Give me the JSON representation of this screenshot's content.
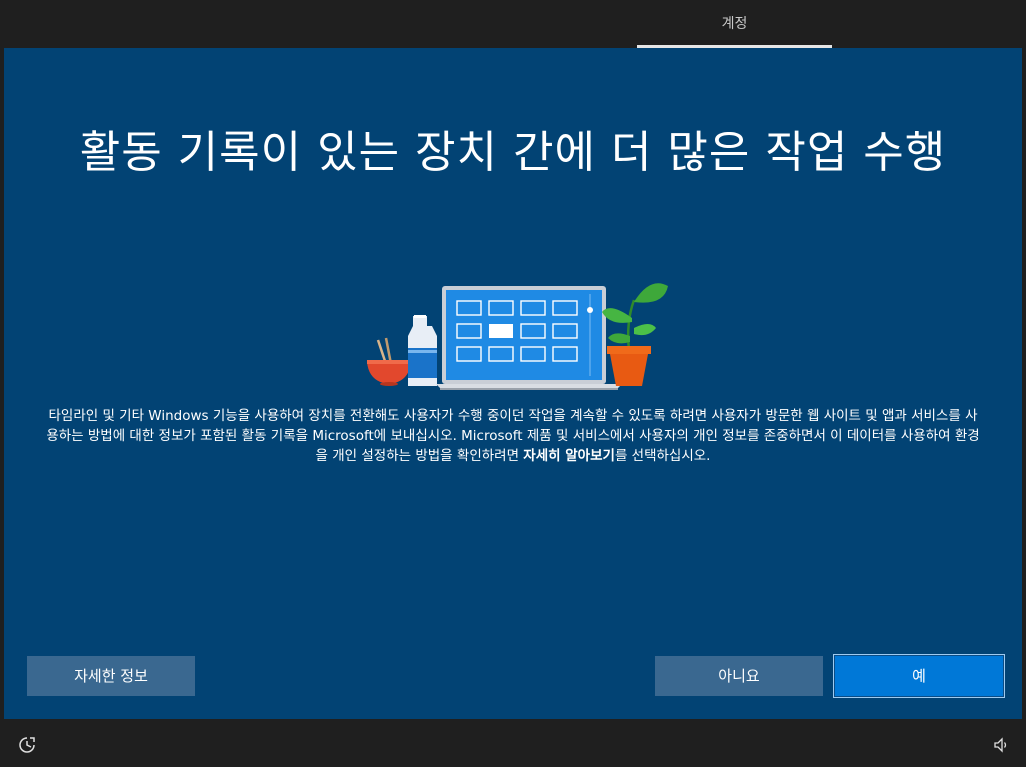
{
  "header": {
    "tab_label": "계정"
  },
  "main": {
    "title": "활동 기록이 있는 장치 간에 더 많은 작업 수행",
    "description_parts": {
      "before_link": "타임라인 및 기타 Windows 기능을 사용하여 장치를 전환해도 사용자가 수행 중이던 작업을 계속할 수 있도록 하려면 사용자가 방문한 웹 사이트 및 앱과 서비스를 사용하는 방법에 대한 정보가 포함된 활동 기록을 Microsoft에 보내십시오. Microsoft 제품 및 서비스에서 사용자의 개인 정보를 존중하면서 이 데이터를 사용하여 환경을 개인 설정하는 방법을 확인하려면 ",
      "link": "자세히 알아보기",
      "after_link": "를 선택하십시오."
    }
  },
  "buttons": {
    "learn_more": "자세한 정보",
    "no": "아니요",
    "yes": "예"
  },
  "footer": {
    "left_icon": "ease-of-access-icon",
    "right_icon": "volume-icon"
  },
  "colors": {
    "background": "#024374",
    "bar": "#1f1f1f",
    "secondary_button": "#3a6890",
    "primary_button": "#0078d7"
  }
}
